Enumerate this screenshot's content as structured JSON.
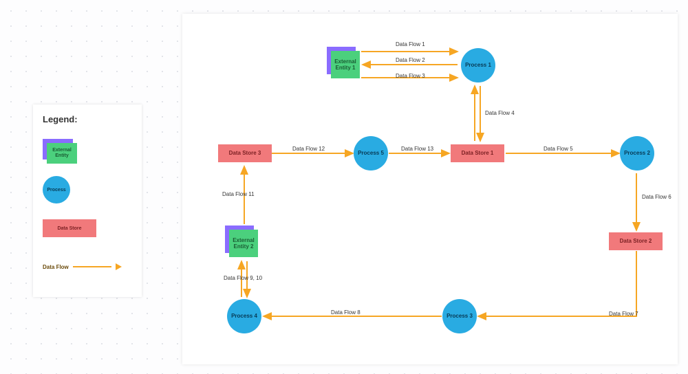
{
  "legend": {
    "title": "Legend:",
    "entity": "External Entity",
    "process": "Process",
    "store": "Data Store",
    "flow": "Data Flow"
  },
  "nodes": {
    "ent1": "External Entity 1",
    "ent2": "External Entity 2",
    "p1": "Process 1",
    "p2": "Process 2",
    "p3": "Process 3",
    "p4": "Process 4",
    "p5": "Process 5",
    "ds1": "Data Store 1",
    "ds2": "Data Store 2",
    "ds3": "Data Store 3"
  },
  "flows": {
    "f1": "Data Flow 1",
    "f2": "Data Flow 2",
    "f3": "Data Flow 3",
    "f4": "Data Flow 4",
    "f5": "Data Flow 5",
    "f6": "Data Flow 6",
    "f7": "Data Flow 7",
    "f8": "Data Flow 8",
    "f9_10": "Data Flow 9, 10",
    "f11": "Data Flow 11",
    "f12": "Data Flow 12",
    "f13": "Data Flow 13"
  },
  "colors": {
    "entity_back": "#8a6cff",
    "entity_front": "#4bd07d",
    "process": "#29abe2",
    "store": "#f1797b",
    "flow": "#f6a623"
  }
}
